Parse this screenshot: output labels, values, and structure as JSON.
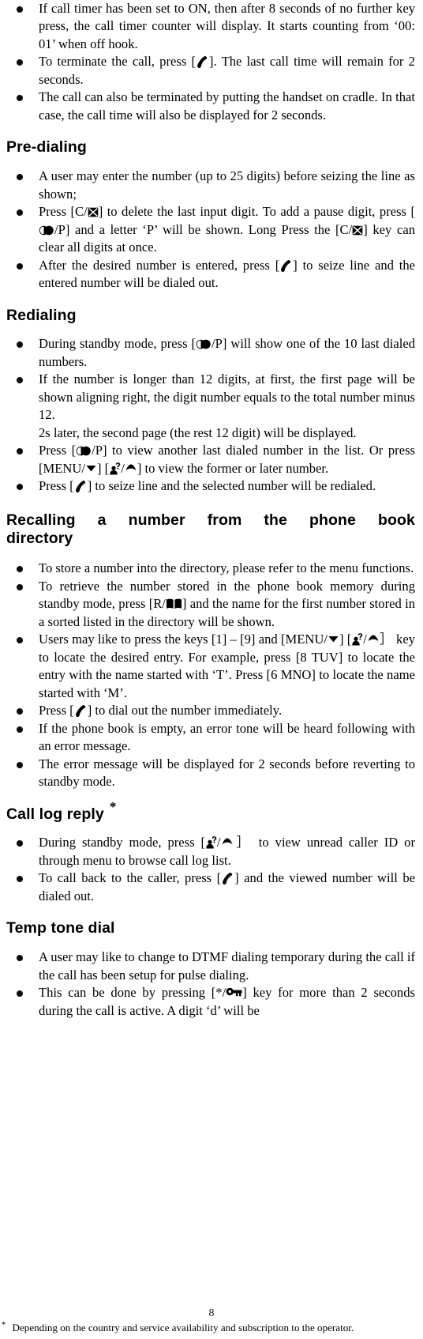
{
  "page": {
    "number": "8",
    "footnote_marker": "*",
    "footnote_text": "Depending on the country and service availability and subscription to the operator."
  },
  "icons": {
    "handset": "phone-handset-icon",
    "redial": "redial-pause-icon",
    "clear": "clear-delete-icon",
    "book": "phone-book-icon",
    "caller": "caller-id-icon",
    "down": "down-arrow-icon",
    "up": "up-arrow-icon",
    "key": "key-icon"
  },
  "intro_bullets": [
    {
      "parts": [
        {
          "t": "If call timer has been set to ON, then after 8 seconds of no further key press, the call timer counter will display. It starts counting from ‘00: 01’ when off hook."
        }
      ]
    },
    {
      "parts": [
        {
          "t": "To terminate the call, press ["
        },
        {
          "icon": "handset"
        },
        {
          "t": "]. The last call time will remain for 2 seconds."
        }
      ]
    },
    {
      "parts": [
        {
          "t": "The call can also be terminated by putting the handset on cradle. In that case, the call time will also be displayed for 2 seconds."
        }
      ]
    }
  ],
  "sections": [
    {
      "id": "pre-dialing",
      "heading": "Pre-dialing",
      "bullets": [
        {
          "parts": [
            {
              "t": "A user may enter the number (up to 25 digits) before seizing the line as shown;"
            }
          ]
        },
        {
          "parts": [
            {
              "t": "Press [C/"
            },
            {
              "icon": "clear"
            },
            {
              "t": "] to delete the last input digit. To add a pause digit, press ["
            },
            {
              "icon": "redial"
            },
            {
              "t": "/P] and a letter ‘P’ will be shown. Long Press the [C/"
            },
            {
              "icon": "clear"
            },
            {
              "t": "] key can clear all digits at once."
            }
          ]
        },
        {
          "parts": [
            {
              "t": "After the desired number is entered, press ["
            },
            {
              "icon": "handset"
            },
            {
              "t": "] to seize line and the entered number will be dialed out."
            }
          ]
        }
      ]
    },
    {
      "id": "redialing",
      "heading": "Redialing",
      "bullets": [
        {
          "parts": [
            {
              "t": "During standby mode, press ["
            },
            {
              "icon": "redial"
            },
            {
              "t": "/P] will show one of the 10 last dialed numbers."
            }
          ]
        },
        {
          "parts": [
            {
              "t": "If the number is longer than 12 digits, at first, the first page will be shown aligning right, the digit number equals to the total number minus 12."
            }
          ],
          "continuation": "2s later, the second page (the rest 12 digit) will be displayed."
        },
        {
          "parts": [
            {
              "t": "Press ["
            },
            {
              "icon": "redial"
            },
            {
              "t": "/P] to view another last dialed number in the list. Or press [MENU/"
            },
            {
              "icon": "down"
            },
            {
              "t": "] ["
            },
            {
              "icon": "caller"
            },
            {
              "t": "/"
            },
            {
              "icon": "up"
            },
            {
              "t": "] to view the  former or later number."
            }
          ]
        },
        {
          "parts": [
            {
              "t": "Press ["
            },
            {
              "icon": "handset"
            },
            {
              "t": "] to seize line and the selected number will be redialed."
            }
          ]
        }
      ]
    },
    {
      "id": "recalling",
      "heading": "Recalling a number from the phone book",
      "heading_line2": "directory",
      "bullets": [
        {
          "parts": [
            {
              "t": "To store a number into the directory, please refer to the menu functions."
            }
          ]
        },
        {
          "parts": [
            {
              "t": "To retrieve the number stored in the phone book memory during standby mode, press [R/"
            },
            {
              "icon": "book"
            },
            {
              "t": "] and the name for the first number stored in a sorted listed in the directory will be shown."
            }
          ]
        },
        {
          "parts": [
            {
              "t": "Users may like to press the keys [1] – [9] and [MENU/"
            },
            {
              "icon": "down"
            },
            {
              "t": "] ["
            },
            {
              "icon": "caller"
            },
            {
              "t": "/"
            },
            {
              "icon": "up"
            },
            {
              "t": "］ key to locate the desired entry. For example, press [8 TUV] to locate the entry with the name started with ‘T’. Press [6 MNO] to locate the name started with ‘M’."
            }
          ]
        },
        {
          "parts": [
            {
              "t": "Press ["
            },
            {
              "icon": "handset"
            },
            {
              "t": "] to dial out the number immediately."
            }
          ]
        },
        {
          "parts": [
            {
              "t": "If the phone book is empty, an error tone will be heard following with an error message."
            }
          ]
        },
        {
          "parts": [
            {
              "t": "The error message will be displayed for 2 seconds before reverting to standby mode."
            }
          ]
        }
      ]
    },
    {
      "id": "call-log-reply",
      "heading": "Call log reply",
      "heading_marker": "*",
      "bullets": [
        {
          "parts": [
            {
              "t": "During standby mode, press ["
            },
            {
              "icon": "caller"
            },
            {
              "t": "/"
            },
            {
              "icon": "up"
            },
            {
              "t": "］ to view unread caller ID or through menu to browse call log list."
            }
          ]
        },
        {
          "parts": [
            {
              "t": "To call back to the caller, press ["
            },
            {
              "icon": "handset"
            },
            {
              "t": "] and the viewed number will be dialed out."
            }
          ]
        }
      ]
    },
    {
      "id": "temp-tone-dial",
      "heading": "Temp tone dial",
      "bullets": [
        {
          "parts": [
            {
              "t": "A user may like to change to DTMF dialing temporary during the call if the call has been setup for pulse dialing."
            }
          ]
        },
        {
          "parts": [
            {
              "t": "This can be done by pressing [*/"
            },
            {
              "icon": "key"
            },
            {
              "t": "] key for more than 2 seconds during the call is active. A digit ‘d’ will be"
            }
          ]
        }
      ]
    }
  ]
}
